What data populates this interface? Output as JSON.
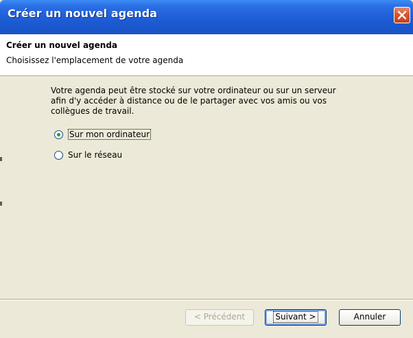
{
  "window": {
    "title": "Créer un nouvel agenda"
  },
  "header": {
    "title": "Créer un nouvel agenda",
    "subtitle": "Choisissez l'emplacement de votre agenda"
  },
  "content": {
    "description_lines": [
      "Votre agenda peut être stocké sur votre ordinateur ou sur un serveur",
      "afin d'y accéder à distance ou de le partager avec vos amis ou vos",
      "collègues de travail."
    ],
    "options": [
      {
        "label": "Sur mon ordinateur",
        "selected": true
      },
      {
        "label": "Sur le réseau",
        "selected": false
      }
    ]
  },
  "footer": {
    "previous_label": "< Précédent",
    "next_label": "Suivant >",
    "cancel_label": "Annuler"
  },
  "colors": {
    "titlebar": "#1f5fd8",
    "dialog_bg": "#ece9d8",
    "radio_selected": "#21a121",
    "close_button": "#d9562f"
  },
  "icons": {
    "close": "close-icon"
  }
}
